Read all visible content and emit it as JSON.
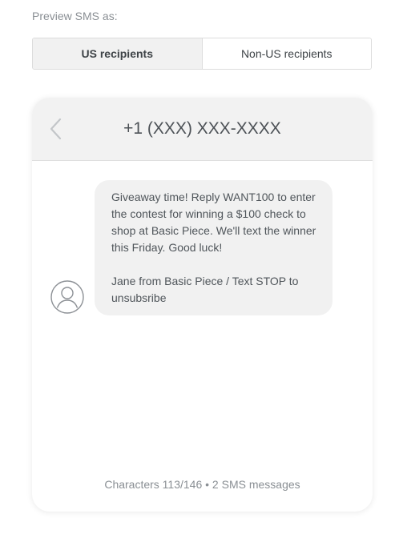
{
  "preview": {
    "label": "Preview SMS as:"
  },
  "recipient_tabs": [
    {
      "label": "US recipients",
      "active": true
    },
    {
      "label": "Non-US recipients",
      "active": false
    }
  ],
  "phone": {
    "number": "+1 (XXX) XXX-XXXX",
    "back_icon": "chevron-left-icon"
  },
  "message": {
    "body": "Giveaway time! Reply WANT100 to enter the contest for winning a $100 check to shop at Basic Piece. We'll text the winner this Friday. Good luck!",
    "signature": "Jane from Basic Piece / Text STOP to unsubsribe",
    "avatar_icon": "user-avatar-icon"
  },
  "footer": {
    "characters": "Characters 113/146 • 2 SMS messages"
  },
  "colors": {
    "header_bg": "#f2f2f2",
    "bubble_bg": "#f1f1f1",
    "active_tab_bg": "#f1f1f1"
  }
}
